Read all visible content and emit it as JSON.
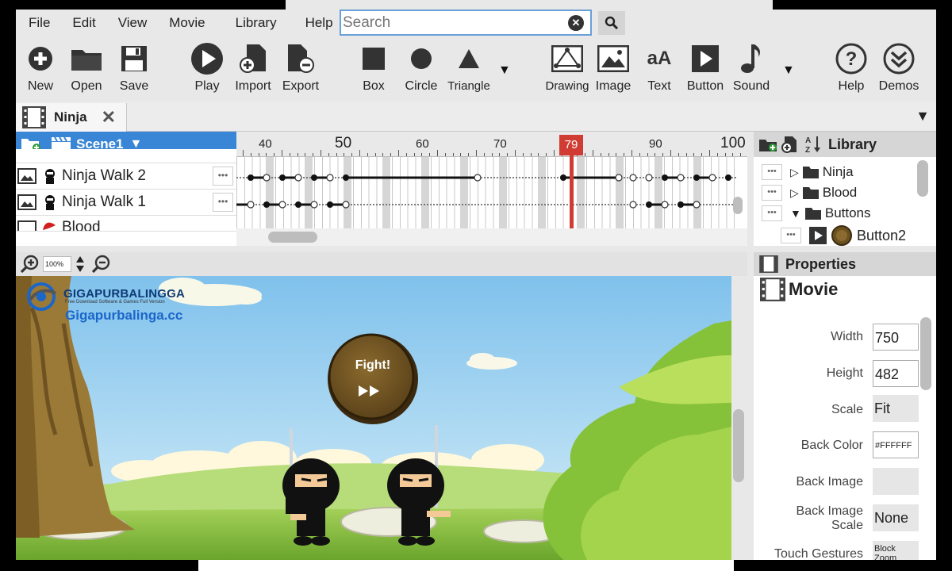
{
  "menu": [
    "File",
    "Edit",
    "View",
    "Movie",
    "Library",
    "Help"
  ],
  "search": {
    "placeholder": "Search"
  },
  "toolbar": {
    "new": "New",
    "open": "Open",
    "save": "Save",
    "play": "Play",
    "import": "Import",
    "export": "Export",
    "box": "Box",
    "circle": "Circle",
    "triangle": "Triangle",
    "drawing": "Drawing",
    "image": "Image",
    "text": "Text",
    "button": "Button",
    "sound": "Sound",
    "help": "Help",
    "demos": "Demos",
    "text_icon_glyph": "aA"
  },
  "doc_tab": {
    "name": "Ninja"
  },
  "timeline": {
    "scene": "Scene1",
    "ruler": [
      "40",
      "50",
      "60",
      "70",
      "90",
      "100"
    ],
    "playhead": "79",
    "layers": [
      "Ninja Walk 2",
      "Ninja Walk 1",
      "Blood"
    ]
  },
  "library": {
    "title": "Library",
    "items": [
      "Ninja",
      "Blood",
      "Buttons",
      "Button2"
    ]
  },
  "zoom": {
    "value": "100%"
  },
  "stage": {
    "watermark_title": "GIGAPURBALINGGA",
    "watermark_sub": "Free Download Software & Games Full Version",
    "watermark_url": "Gigapurbalinga.cc",
    "fight": "Fight!"
  },
  "properties": {
    "title": "Properties",
    "object": "Movie",
    "width_label": "Width",
    "width": "750",
    "height_label": "Height",
    "height": "482",
    "scale_label": "Scale",
    "scale": "Fit",
    "backcolor_label": "Back Color",
    "backcolor": "#FFFFFF",
    "backimage_label": "Back Image",
    "backimagescale_label": "Back Image Scale",
    "backimagescale": "None",
    "touch_label": "Touch Gestures",
    "touch": "Block Zoom"
  },
  "colors": {
    "accent": "#3a86d6",
    "playhead": "#d03c33"
  }
}
